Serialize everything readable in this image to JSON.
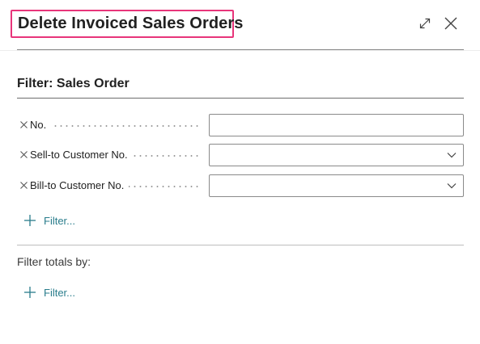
{
  "dialog": {
    "title": "Delete Invoiced Sales Orders",
    "icons": {
      "expand": "expand-icon",
      "close": "close-icon"
    },
    "highlight_color": "#e8357a"
  },
  "filter_section": {
    "title": "Filter: Sales Order",
    "fields": [
      {
        "label": "No.",
        "value": "",
        "type": "text"
      },
      {
        "label": "Sell-to Customer No.",
        "value": "",
        "type": "select"
      },
      {
        "label": "Bill-to Customer No.",
        "value": "",
        "type": "select"
      }
    ],
    "add_filter_label": "Filter..."
  },
  "totals_section": {
    "title": "Filter totals by:",
    "add_filter_label": "Filter..."
  },
  "colors": {
    "link": "#2a7d8c",
    "text": "#212121"
  }
}
